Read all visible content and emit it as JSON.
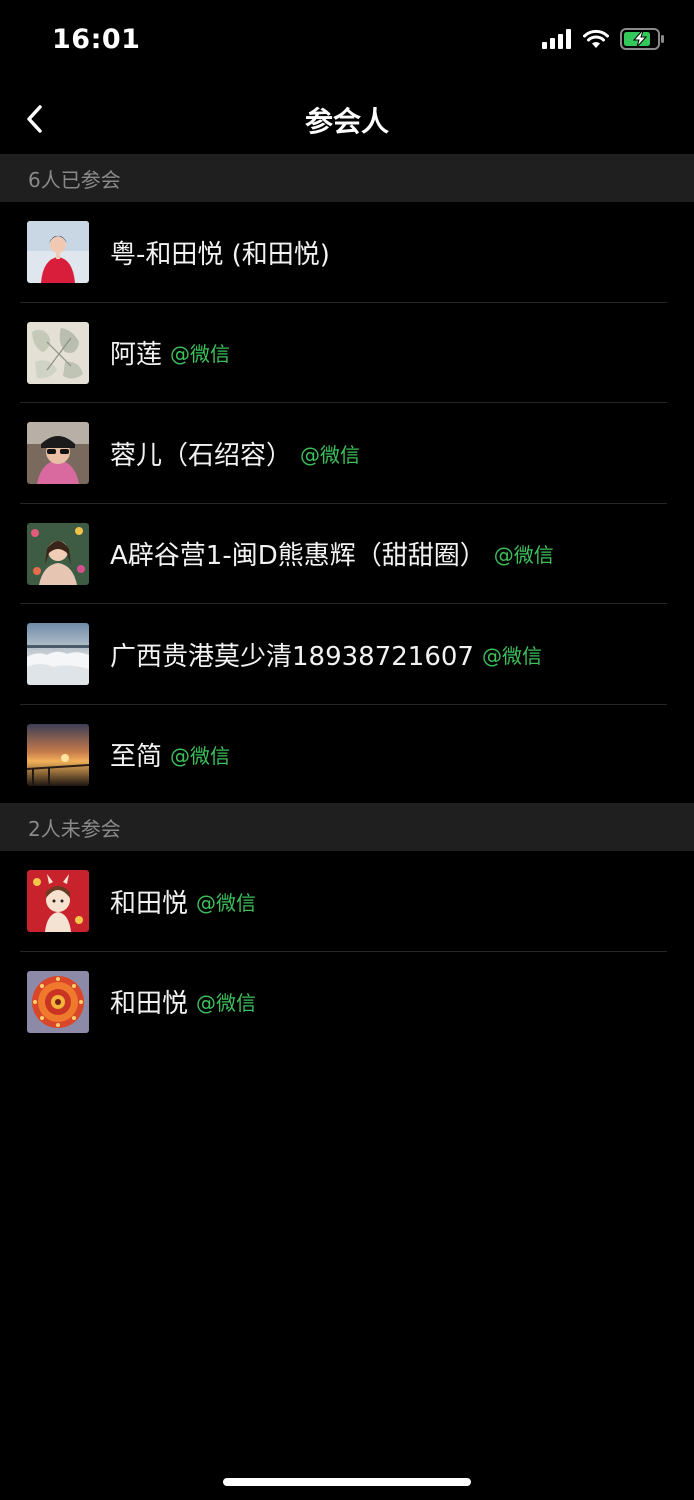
{
  "status_bar": {
    "time": "16:01"
  },
  "nav": {
    "title": "参会人"
  },
  "sections": {
    "joined": {
      "header": "6人已参会",
      "members": [
        {
          "name": "粤-和田悦 (和田悦)",
          "tag": ""
        },
        {
          "name": "阿莲",
          "tag": "@微信"
        },
        {
          "name": "蓉儿（石绍容）",
          "tag": "@微信"
        },
        {
          "name": "A辟谷营1-闽D熊惠辉（甜甜圈）",
          "tag": "@微信"
        },
        {
          "name": "广西贵港莫少清18938721607",
          "tag": "@微信"
        },
        {
          "name": "至简",
          "tag": "@微信"
        }
      ]
    },
    "not_joined": {
      "header": "2人未参会",
      "members": [
        {
          "name": "和田悦",
          "tag": "@微信"
        },
        {
          "name": "和田悦",
          "tag": "@微信"
        }
      ]
    }
  },
  "colors": {
    "accent_green": "#3dbf5c",
    "section_bg": "#1f1f1f",
    "background": "#000000"
  }
}
